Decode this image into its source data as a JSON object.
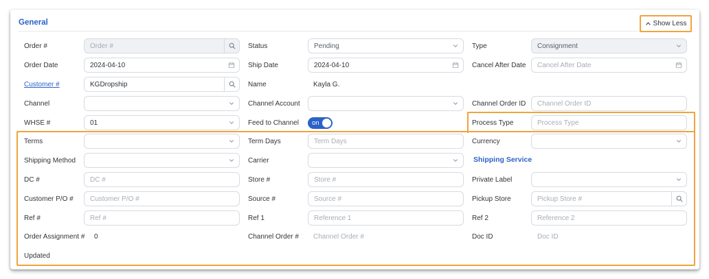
{
  "section": {
    "title": "General",
    "show_less_label": "Show Less"
  },
  "colors": {
    "accent": "#2a63c8",
    "highlight": "#f0a33b",
    "border": "#d6dae0",
    "placeholder": "#a7adb6"
  },
  "fields": {
    "order_number": {
      "label": "Order #",
      "placeholder": "Order #"
    },
    "status": {
      "label": "Status",
      "value": "Pending"
    },
    "type": {
      "label": "Type",
      "value": "Consignment"
    },
    "order_date": {
      "label": "Order Date",
      "value": "2024-04-10"
    },
    "ship_date": {
      "label": "Ship Date",
      "value": "2024-04-10"
    },
    "cancel_after_date": {
      "label": "Cancel After Date",
      "placeholder": "Cancel After Date"
    },
    "customer": {
      "label": "Customer #",
      "value": "KGDropship"
    },
    "name": {
      "label": "Name",
      "value": "Kayla G."
    },
    "channel": {
      "label": "Channel",
      "value": ""
    },
    "channel_account": {
      "label": "Channel Account",
      "value": ""
    },
    "channel_order_id": {
      "label": "Channel Order ID",
      "placeholder": "Channel Order ID"
    },
    "whse": {
      "label": "WHSE #",
      "value": "01"
    },
    "feed_to_channel": {
      "label": "Feed to Channel",
      "toggle_text": "on"
    },
    "process_type": {
      "label": "Process Type",
      "placeholder": "Process Type"
    },
    "terms": {
      "label": "Terms",
      "value": ""
    },
    "term_days": {
      "label": "Term Days",
      "placeholder": "Term Days"
    },
    "currency": {
      "label": "Currency",
      "value": ""
    },
    "shipping_method": {
      "label": "Shipping Method",
      "value": ""
    },
    "carrier": {
      "label": "Carrier",
      "value": ""
    },
    "shipping_service": {
      "label": "Shipping Service"
    },
    "dc": {
      "label": "DC #",
      "placeholder": "DC #"
    },
    "store": {
      "label": "Store #",
      "placeholder": "Store #"
    },
    "private_label": {
      "label": "Private Label",
      "value": ""
    },
    "customer_po": {
      "label": "Customer P/O #",
      "placeholder": "Customer P/O #"
    },
    "source": {
      "label": "Source #",
      "placeholder": "Source #"
    },
    "pickup_store": {
      "label": "Pickup Store",
      "placeholder": "Pickup Store #"
    },
    "ref": {
      "label": "Ref #",
      "placeholder": "Ref #"
    },
    "ref1": {
      "label": "Ref 1",
      "placeholder": "Reference 1"
    },
    "ref2": {
      "label": "Ref 2",
      "placeholder": "Reference 2"
    },
    "order_assignment": {
      "label": "Order Assignment #",
      "value": "0"
    },
    "channel_order": {
      "label": "Channel Order #",
      "placeholder": "Channel Order #"
    },
    "doc_id": {
      "label": "Doc ID",
      "placeholder": "Doc ID"
    },
    "updated": {
      "label": "Updated"
    }
  }
}
